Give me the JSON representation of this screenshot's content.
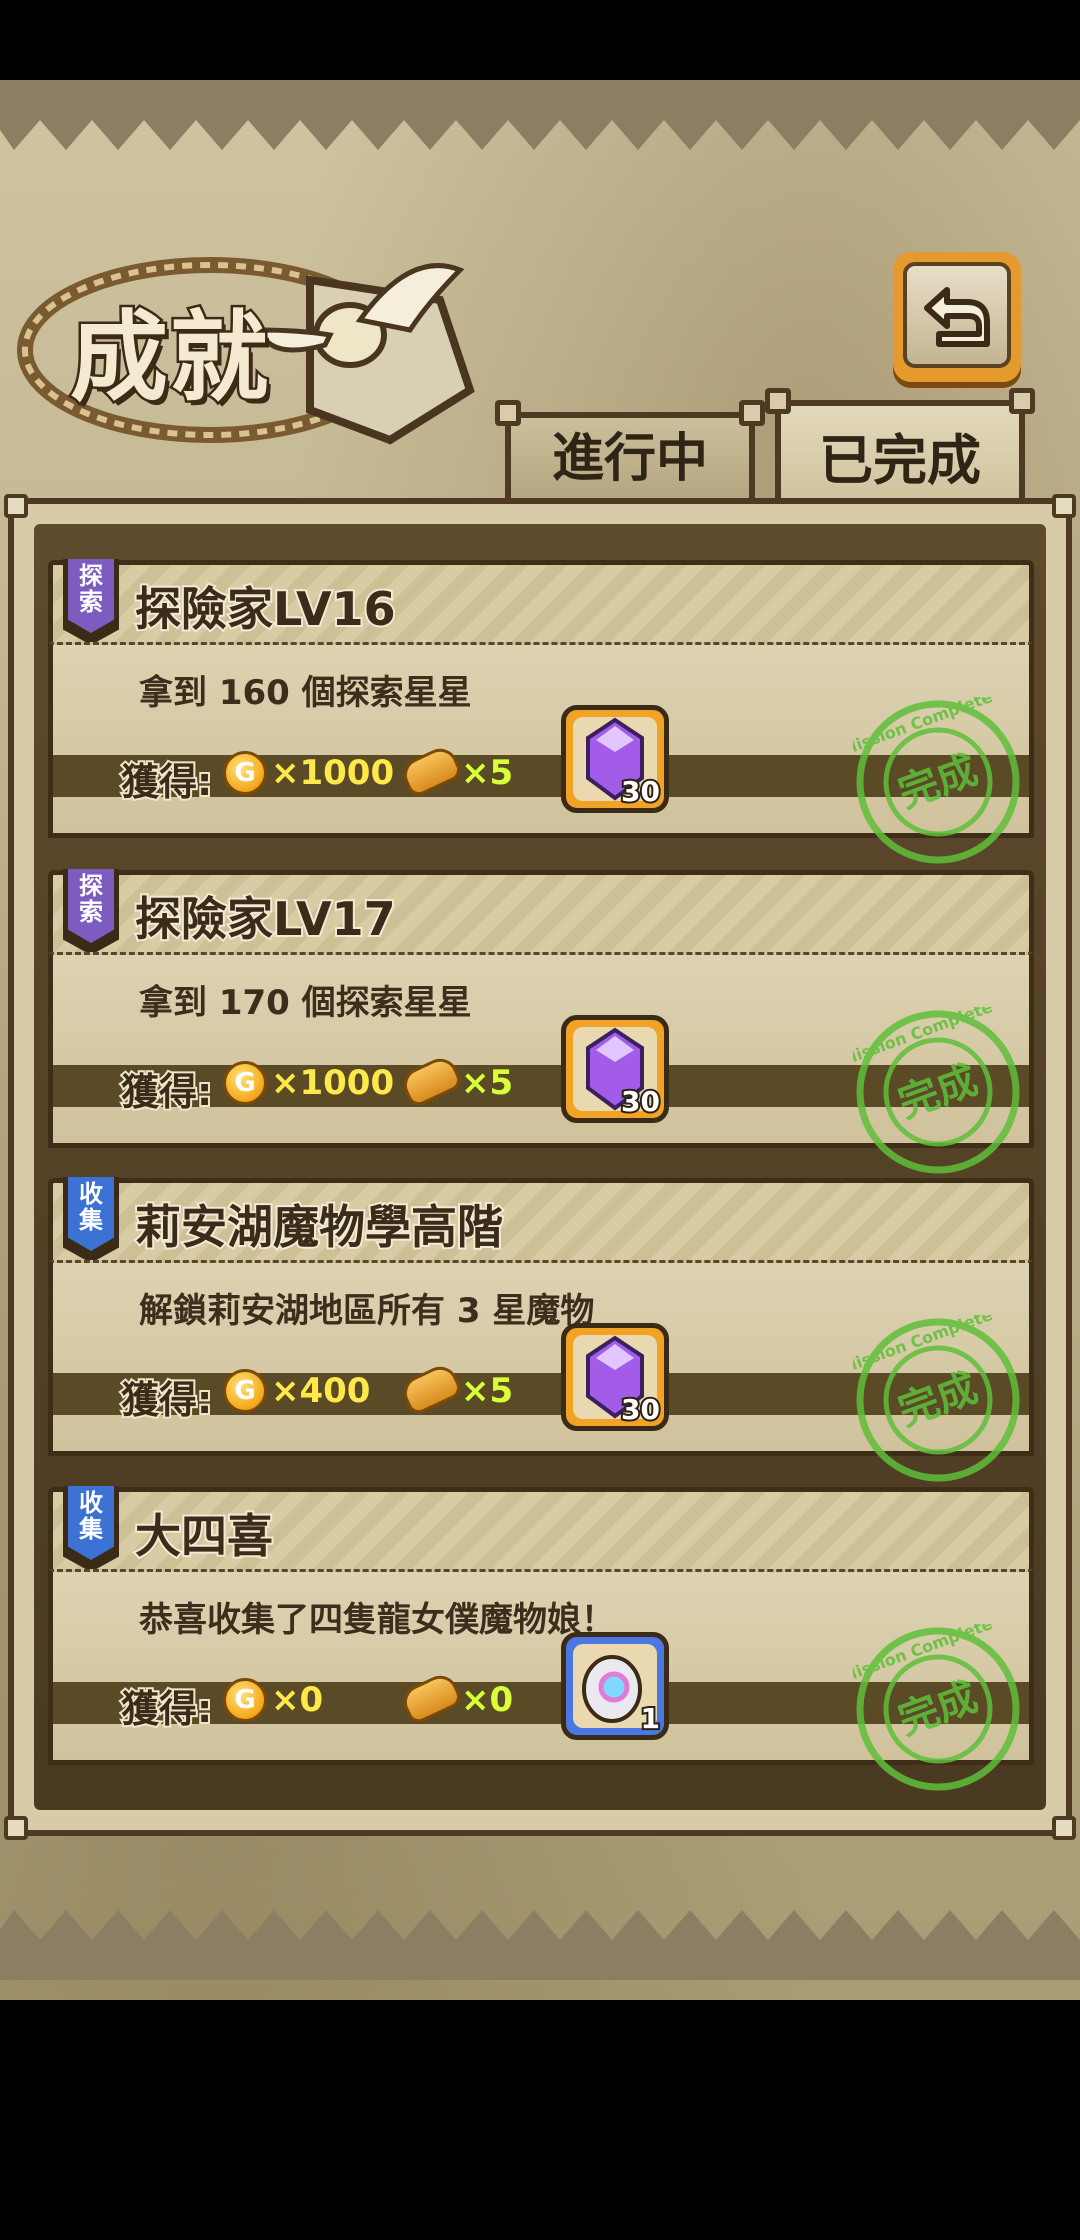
{
  "header": {
    "title": "成就"
  },
  "tabs": [
    {
      "label": "進行中",
      "active": false
    },
    {
      "label": "已完成",
      "active": true
    }
  ],
  "reward_label": "獲得:",
  "coin_symbol": "G",
  "stamp": {
    "label": "完成",
    "ring_text": "Mission Complete",
    "color": "#5fbf3a"
  },
  "achievements": [
    {
      "category": "探索",
      "category_color": "#7d5cc0",
      "title": "探險家LV16",
      "description": "拿到 160 個探索星星",
      "gold": "×1000",
      "bread": "×5",
      "item": {
        "icon": "purple-gem-icon",
        "count": "30",
        "frame": "gold"
      }
    },
    {
      "category": "探索",
      "category_color": "#7d5cc0",
      "title": "探險家LV17",
      "description": "拿到 170 個探索星星",
      "gold": "×1000",
      "bread": "×5",
      "item": {
        "icon": "purple-gem-icon",
        "count": "30",
        "frame": "gold"
      }
    },
    {
      "category": "收集",
      "category_color": "#3b72d4",
      "title": "莉安湖魔物學高階",
      "description": "解鎖莉安湖地區所有 3 星魔物",
      "gold": "×400",
      "bread": "×5",
      "item": {
        "icon": "purple-gem-icon",
        "count": "30",
        "frame": "gold"
      }
    },
    {
      "category": "收集",
      "category_color": "#3b72d4",
      "title": "大四喜",
      "description": "恭喜收集了四隻龍女僕魔物娘！",
      "gold": "×0",
      "bread": "×0",
      "item": {
        "icon": "monster-egg-icon",
        "count": "1",
        "frame": "blue"
      }
    }
  ]
}
